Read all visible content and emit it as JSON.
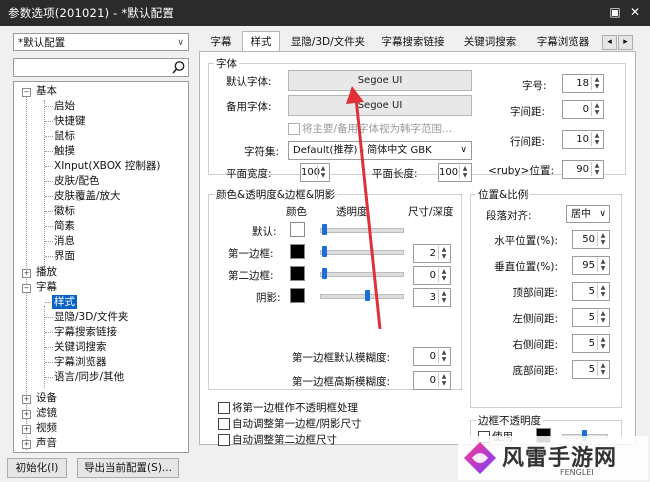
{
  "window": {
    "title": "参数选项(201021) - *默认配置",
    "pin_glyph": "▣",
    "close_glyph": "✕"
  },
  "profile_select": {
    "value": "*默认配置"
  },
  "search": {
    "value": ""
  },
  "tree": {
    "items": [
      {
        "label": "基本"
      },
      {
        "label": "启始"
      },
      {
        "label": "快捷键"
      },
      {
        "label": "鼠标"
      },
      {
        "label": "触摸"
      },
      {
        "label": "XInput(XBOX 控制器)"
      },
      {
        "label": "皮肤/配色"
      },
      {
        "label": "皮肤覆盖/放大"
      },
      {
        "label": "徽标"
      },
      {
        "label": "简素"
      },
      {
        "label": "消息"
      },
      {
        "label": "界面"
      },
      {
        "label": "播放"
      },
      {
        "label": "字幕"
      },
      {
        "label": "样式"
      },
      {
        "label": "显隐/3D/文件夹"
      },
      {
        "label": "字幕搜索链接"
      },
      {
        "label": "关键词搜索"
      },
      {
        "label": "字幕浏览器"
      },
      {
        "label": "语言/同步/其他"
      },
      {
        "label": "设备"
      },
      {
        "label": "滤镜"
      },
      {
        "label": "视频"
      },
      {
        "label": "声音"
      }
    ]
  },
  "bottom": {
    "init_button": "初始化(I)",
    "export_button": "导出当前配置(S)..."
  },
  "tabs": [
    {
      "label": "字幕"
    },
    {
      "label": "样式"
    },
    {
      "label": "显隐/3D/文件夹"
    },
    {
      "label": "字幕搜索链接"
    },
    {
      "label": "关键词搜索"
    },
    {
      "label": "字幕浏览器"
    }
  ],
  "tab_scroll": {
    "left": "◂",
    "right": "▸"
  },
  "font_group": {
    "title": "字体",
    "default_font_label": "默认字体:",
    "default_font_value": "Segoe UI",
    "backup_font_label": "备用字体:",
    "backup_font_value": "Segoe UI",
    "korean_checkbox": "将主要/备用字体视为韩字范围...",
    "charset_label": "字符集:",
    "charset_value": "Default(推荐) - 简体中文 GBK",
    "plane_width_label": "平面宽度:",
    "plane_width_value": "100",
    "plane_length_label": "平面长度:",
    "plane_length_value": "100",
    "size_label": "字号:",
    "size_value": "18",
    "char_spacing_label": "字间距:",
    "char_spacing_value": "0",
    "line_spacing_label": "行间距:",
    "line_spacing_value": "10",
    "ruby_label": "<ruby>位置:",
    "ruby_value": "90"
  },
  "color_group": {
    "title": "颜色&透明度&边框&阴影",
    "col_color": "颜色",
    "col_opacity": "透明度",
    "col_size": "尺寸/深度",
    "rows": [
      {
        "label": "默认:",
        "color": "#ffffff",
        "opacity_level": 0.02,
        "size": ""
      },
      {
        "label": "第一边框:",
        "color": "#000000",
        "opacity_level": 0.02,
        "size": "2"
      },
      {
        "label": "第二边框:",
        "color": "#000000",
        "opacity_level": 0.02,
        "size": "0"
      },
      {
        "label": "阴影:",
        "color": "#000000",
        "opacity_level": 0.55,
        "size": "3"
      }
    ],
    "blur1_label": "第一边框默认模糊度:",
    "blur1_value": "0",
    "blur2_label": "第一边框高斯模糊度:",
    "blur2_value": "0"
  },
  "checkboxes": [
    {
      "label": "将第一边框作不透明框处理"
    },
    {
      "label": "自动调整第一边框/阴影尺寸"
    },
    {
      "label": "自动调整第二边框尺寸"
    }
  ],
  "position_group": {
    "title": "位置&比例",
    "align_label": "段落对齐:",
    "align_value": "居中",
    "rows": [
      {
        "label": "水平位置(%):",
        "value": "50"
      },
      {
        "label": "垂直位置(%):",
        "value": "95"
      },
      {
        "label": "顶部间距:",
        "value": "5"
      },
      {
        "label": "左侧间距:",
        "value": "5"
      },
      {
        "label": "右侧间距:",
        "value": "5"
      },
      {
        "label": "底部间距:",
        "value": "5"
      }
    ]
  },
  "opaque_group": {
    "title": "边框不透明度",
    "use_label": "使用",
    "color": "#000000",
    "opacity_level": 0.45
  },
  "watermark": {
    "name": "风雷手游网",
    "sub": "FENGLEI"
  },
  "colors": {
    "titlebar": "#2b2b2b",
    "selection": "#0a64c8",
    "annotation_arrow": "#e0303a",
    "slider_thumb": "#1a6fd8"
  }
}
